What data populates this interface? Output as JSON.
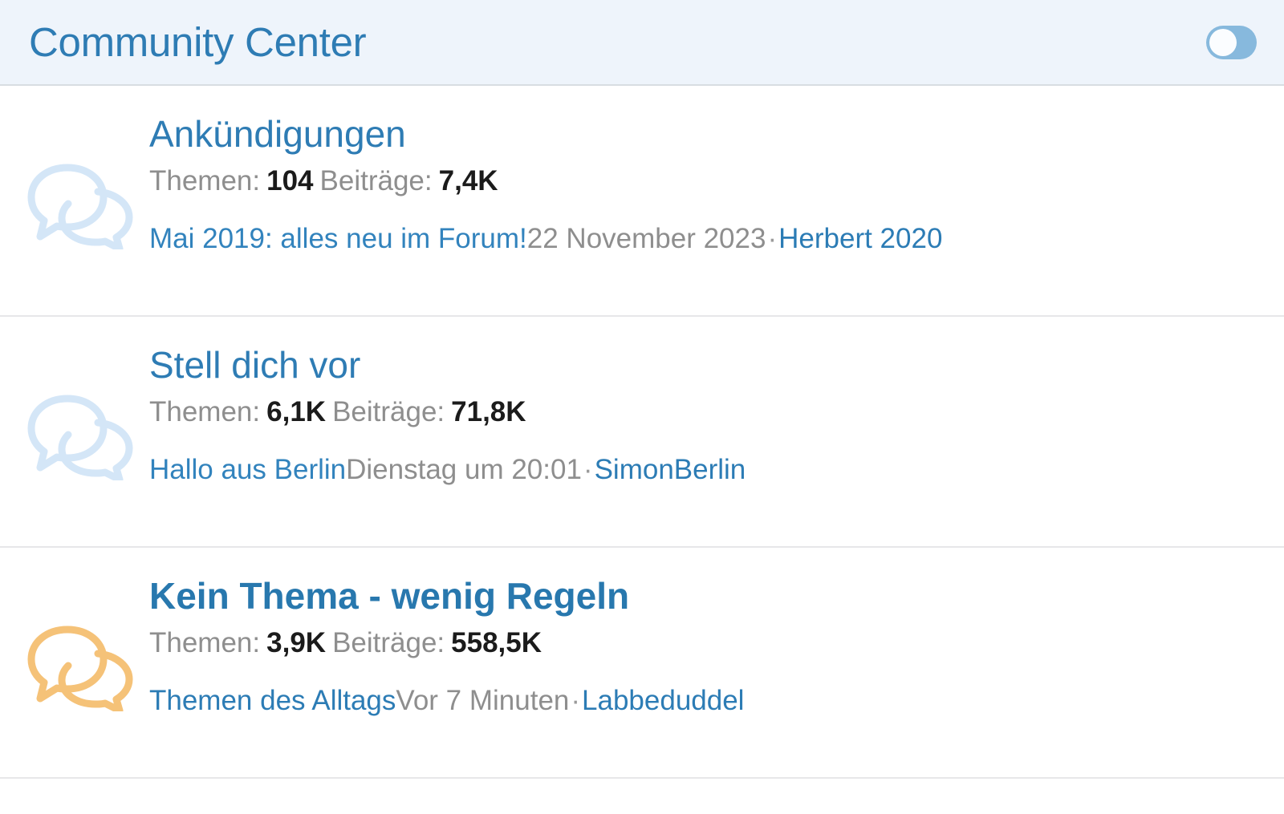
{
  "header": {
    "title": "Community Center",
    "toggle": {
      "name": "collapse-toggle",
      "state": "off",
      "track_color": "#87b9dd",
      "knob_color": "#fbfdff"
    },
    "background_color": "#eef4fb",
    "title_color": "#2e7cb4"
  },
  "labels": {
    "threads": "Themen:",
    "messages": "Beiträge:",
    "separator": "·"
  },
  "colors": {
    "link_blue": "#2e7cb4",
    "muted_gray": "#8e8e8e",
    "value_black": "#1b1b1b",
    "icon_read": "#d4e6f7",
    "icon_unread": "#f5c278",
    "divider": "#e7e7e9"
  },
  "forums": [
    {
      "title": "Ankündigungen",
      "unread": false,
      "icon": "speech-bubbles-icon",
      "icon_color": "#d4e6f7",
      "threads_label": "Themen:",
      "threads_value": "104",
      "messages_label": "Beiträge:",
      "messages_value": "7,4K",
      "last_post": {
        "thread_title": "Mai 2019: alles neu im Forum!",
        "timestamp": "22 November 2023",
        "separator": "·",
        "author": "Herbert 2020"
      }
    },
    {
      "title": "Stell dich vor",
      "unread": false,
      "icon": "speech-bubbles-icon",
      "icon_color": "#d4e6f7",
      "threads_label": "Themen:",
      "threads_value": "6,1K",
      "messages_label": "Beiträge:",
      "messages_value": "71,8K",
      "last_post": {
        "thread_title": "Hallo aus Berlin",
        "timestamp": "Dienstag um 20:01",
        "separator": "·",
        "author": "SimonBerlin"
      }
    },
    {
      "title": "Kein Thema - wenig Regeln",
      "unread": true,
      "icon": "speech-bubbles-icon",
      "icon_color": "#f5c278",
      "threads_label": "Themen:",
      "threads_value": "3,9K",
      "messages_label": "Beiträge:",
      "messages_value": "558,5K",
      "last_post": {
        "thread_title": "Themen des Alltags",
        "timestamp": "Vor 7 Minuten",
        "separator": "·",
        "author": "Labbeduddel"
      }
    }
  ]
}
